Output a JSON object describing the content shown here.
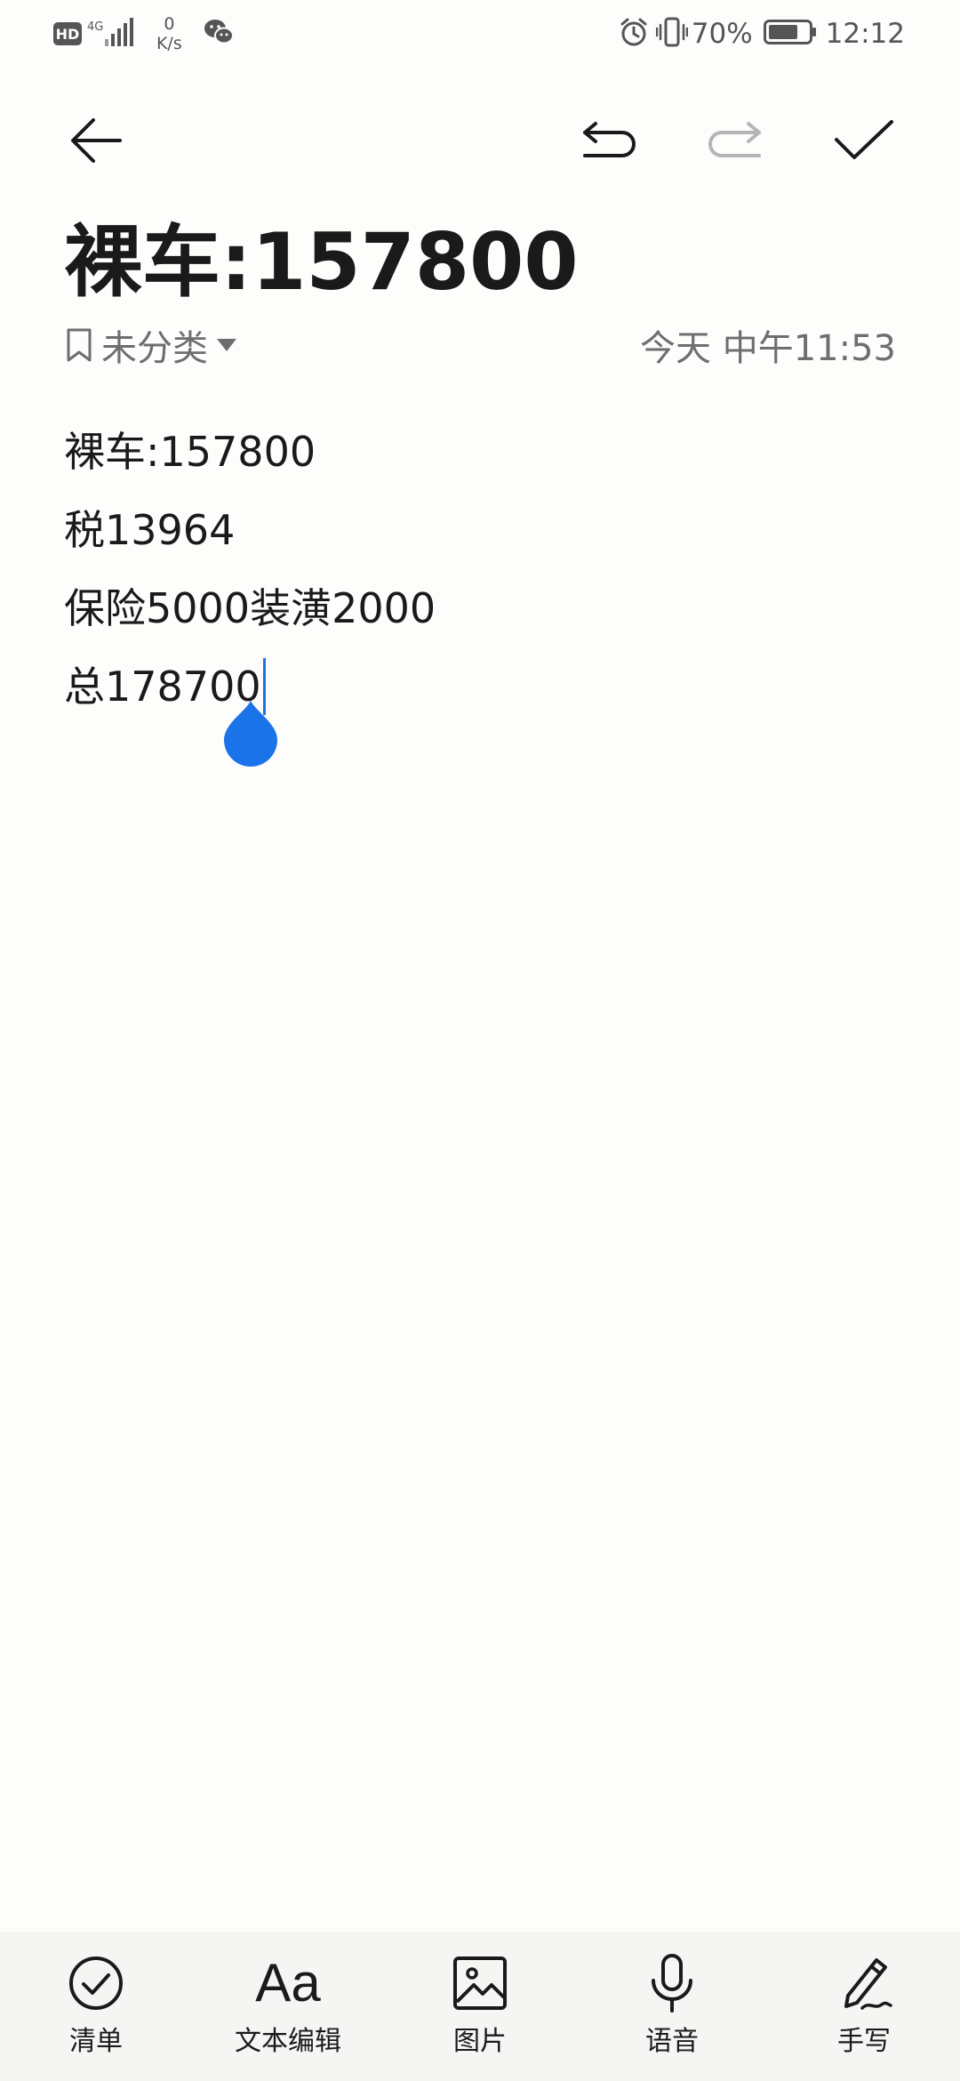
{
  "status_bar": {
    "hd_badge": "HD",
    "network_type": "4G",
    "net_speed_value": "0",
    "net_speed_unit": "K/s",
    "battery_percent": "70%",
    "time": "12:12",
    "icons": [
      "hd-icon",
      "signal-icon",
      "wechat-icon",
      "alarm-icon",
      "vibrate-icon",
      "battery-icon"
    ]
  },
  "toolbar": {
    "icons": [
      "back-arrow-icon",
      "undo-icon",
      "redo-icon",
      "checkmark-icon"
    ]
  },
  "note": {
    "title": "裸车:157800",
    "category": "未分类",
    "timestamp": "今天 中午11:53",
    "lines": [
      "裸车:157800",
      "税13964",
      "保险5000装潢2000",
      "总178700"
    ]
  },
  "bottom_bar": {
    "items": [
      {
        "label": "清单",
        "icon": "checklist-icon"
      },
      {
        "label": "Aa",
        "icon": "text-format-icon"
      },
      {
        "label": "文本编辑",
        "icon": "text-format-icon"
      },
      {
        "label": "图片",
        "icon": "image-icon"
      },
      {
        "label": "语音",
        "icon": "microphone-icon"
      },
      {
        "label": "手写",
        "icon": "pen-icon"
      }
    ]
  },
  "colors": {
    "background": "#fdfdfb",
    "text": "#1a1a1a",
    "secondary_text": "#6e6e6e",
    "accent": "#1a73e8",
    "disabled": "#b5b5b5"
  }
}
